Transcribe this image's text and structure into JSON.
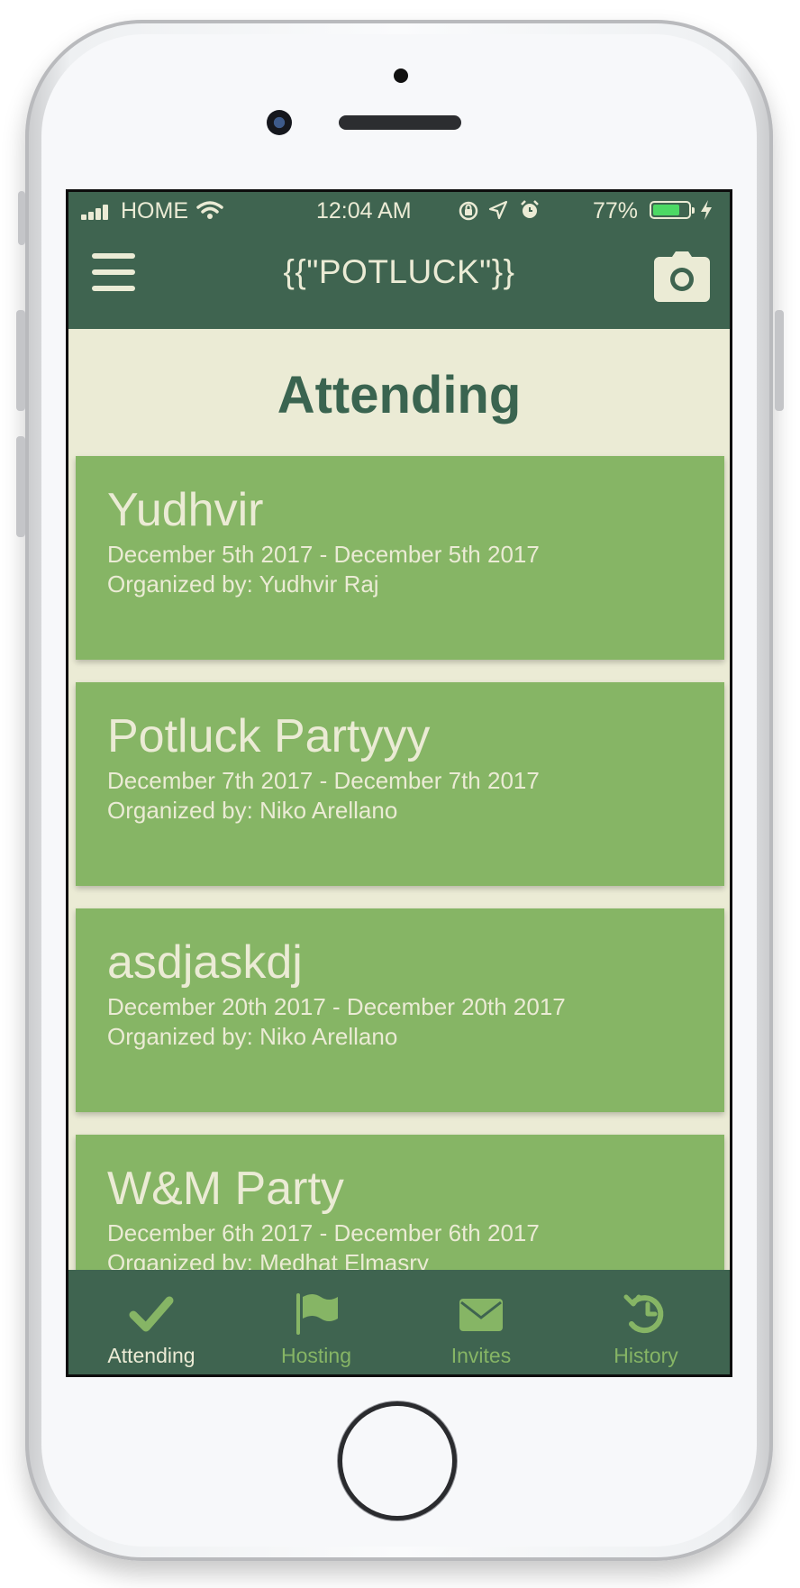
{
  "status_bar": {
    "carrier": "HOME",
    "time": "12:04 AM",
    "battery_percent": "77%",
    "battery_level": 0.77,
    "icons": [
      "signal-icon",
      "wifi-icon",
      "rotation-lock-icon",
      "location-icon",
      "alarm-icon",
      "battery-icon",
      "charging-icon"
    ]
  },
  "header": {
    "title": "{{\"POTLUCK\"}}",
    "menu_icon": "hamburger-menu-icon",
    "camera_icon": "camera-icon"
  },
  "page": {
    "title": "Attending"
  },
  "events": [
    {
      "name": "Yudhvir",
      "dates": "December 5th 2017 - December 5th 2017",
      "organizer": "Organized by: Yudhvir Raj"
    },
    {
      "name": "Potluck Partyyy",
      "dates": "December 7th 2017 - December 7th 2017",
      "organizer": "Organized by: Niko Arellano"
    },
    {
      "name": "asdjaskdj",
      "dates": "December 20th 2017 - December 20th 2017",
      "organizer": "Organized by: Niko Arellano"
    },
    {
      "name": "W&M Party",
      "dates": "December 6th 2017 - December 6th 2017",
      "organizer": "Organized by: Medhat Elmasry"
    }
  ],
  "tabs": [
    {
      "label": "Attending",
      "icon": "checkmark-icon",
      "active": true
    },
    {
      "label": "Hosting",
      "icon": "flag-icon",
      "active": false
    },
    {
      "label": "Invites",
      "icon": "envelope-icon",
      "active": false
    },
    {
      "label": "History",
      "icon": "history-icon",
      "active": false
    }
  ],
  "colors": {
    "header_bg": "#3f6450",
    "page_bg": "#ebebd5",
    "card_bg": "#86b565",
    "text_light": "#ebebd5",
    "title_green": "#3a6450",
    "tab_active": "#ebebd5",
    "tab_icon": "#86b565",
    "battery_fill": "#4cd964"
  }
}
